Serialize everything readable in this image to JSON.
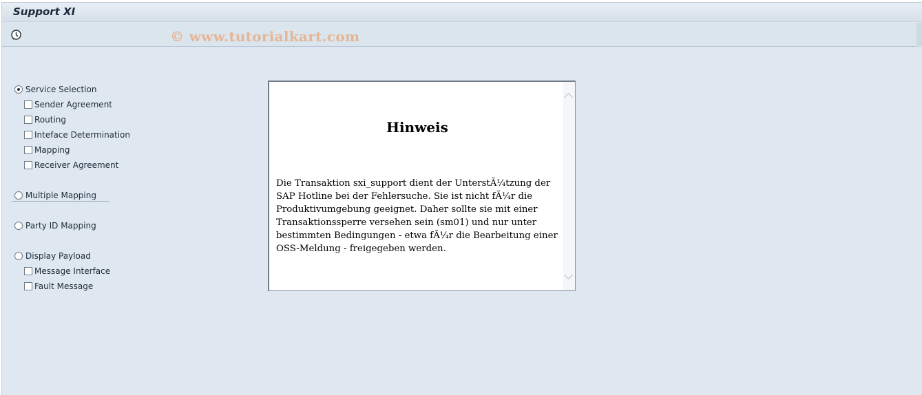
{
  "window": {
    "title": "Support XI"
  },
  "toolbar": {
    "execute_icon": "execute-icon",
    "watermark": "© www.tutorialkart.com"
  },
  "options": {
    "service_selection": {
      "label": "Service Selection",
      "selected": true
    },
    "sender_agreement": "Sender Agreement",
    "routing": "Routing",
    "interface_determination": "Inteface Determination",
    "mapping": "Mapping",
    "receiver_agreement": "Receiver Agreement",
    "multiple_mapping": "Multiple Mapping",
    "party_id_mapping": "Party ID Mapping",
    "display_payload": "Display Payload",
    "message_interface": "Message Interface",
    "fault_message": "Fault Message"
  },
  "notice": {
    "heading": "Hinweis",
    "text": "Die Transaktion sxi_support dient der UnterstÃ¼tzung der SAP Hotline bei der Fehlersuche. Sie ist nicht fÃ¼r die Produktivumgebung geeignet. Daher sollte sie mit einer Transaktionssperre versehen sein (sm01) und nur unter bestimmten Bedingungen - etwa fÃ¼r die Bearbeitung einer OSS-Meldung - freigegeben werden."
  },
  "colors": {
    "background": "#dfe8f1",
    "title": "#1a2a3a",
    "watermark": "#e8a678"
  }
}
